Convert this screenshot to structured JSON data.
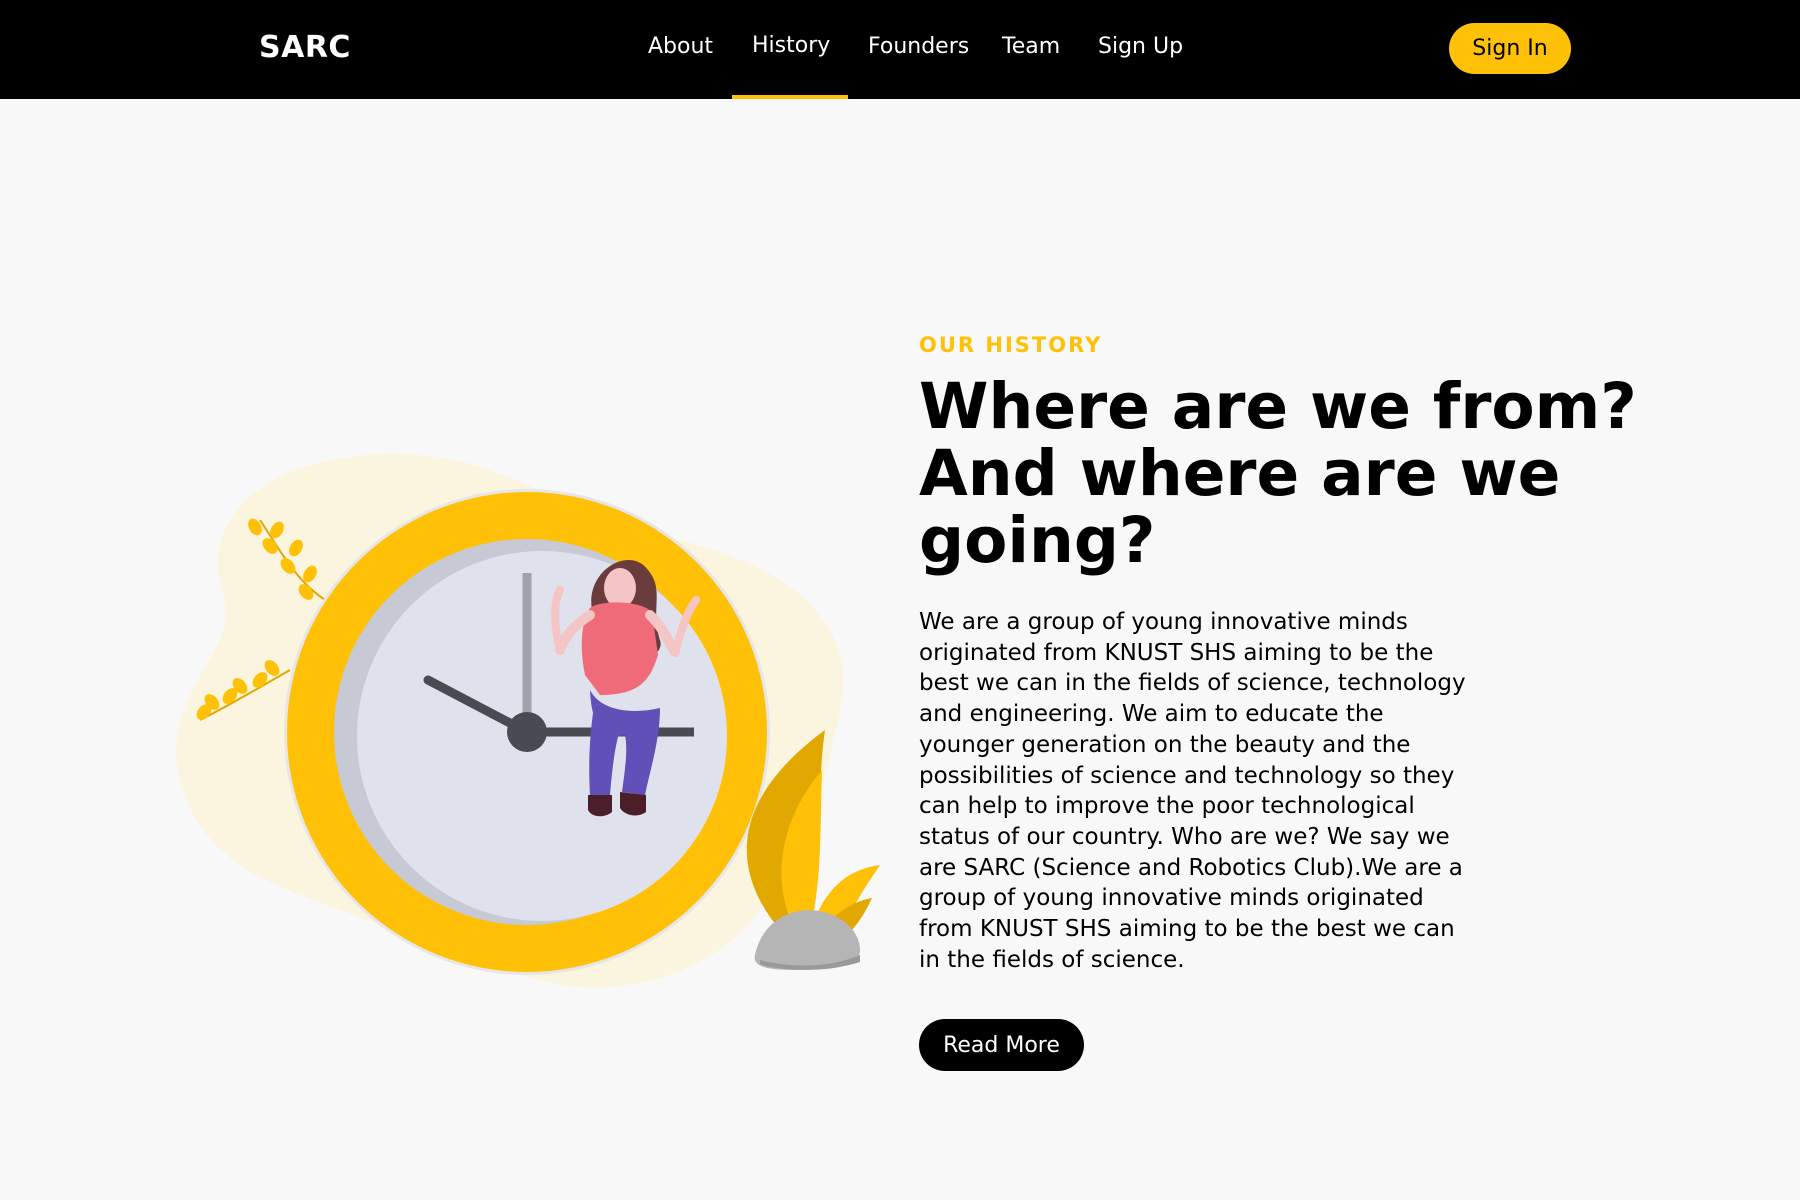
{
  "brand": {
    "logo": "SARC"
  },
  "nav": {
    "items": [
      {
        "label": "About"
      },
      {
        "label": "History"
      },
      {
        "label": "Founders"
      },
      {
        "label": "Team"
      },
      {
        "label": "Sign Up"
      }
    ],
    "active": "History",
    "signin_label": "Sign In"
  },
  "hero": {
    "eyebrow": "OUR HISTORY",
    "headline": "Where are we from? And where are we going?",
    "body": "We are a group of young innovative minds originated from KNUST SHS aiming to be the best we can in the fields of science, technology and engineering. We aim to educate the younger generation on the beauty and the possibilities of science and technology so they can help to improve the poor technological status of our country. Who are we? We say we are SARC (Science and Robotics Club).We are a group of young innovative minds originated from KNUST SHS aiming to be the best we can in the fields of science.",
    "read_more_label": "Read More"
  },
  "illustration": {
    "icon": "clock-woman-illustration"
  },
  "colors": {
    "accent": "#ffc107",
    "nav_bg": "#000000",
    "page_bg": "#f8f8f8",
    "text": "#000000"
  }
}
